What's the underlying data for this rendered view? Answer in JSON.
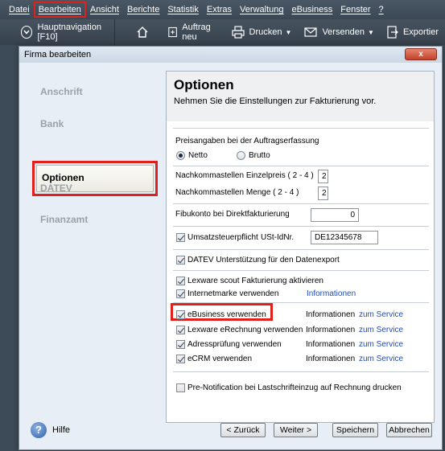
{
  "menu": [
    "Datei",
    "Bearbeiten",
    "Ansicht",
    "Berichte",
    "Statistik",
    "Extras",
    "Verwaltung",
    "eBusiness",
    "Fenster",
    "?"
  ],
  "toolbar": {
    "hauptnav": "Hauptnavigation [F10]",
    "auftrag": "Auftrag neu",
    "drucken": "Drucken",
    "versenden": "Versenden",
    "exportieren": "Exportier"
  },
  "dialog": {
    "title": "Firma bearbeiten",
    "close": "x"
  },
  "nav": {
    "anschrift": "Anschrift",
    "bank": "Bank",
    "optionen": "Optionen",
    "datev": "DATEV",
    "finanzamt": "Finanzamt"
  },
  "panel": {
    "title": "Optionen",
    "subtitle": "Nehmen Sie die Einstellungen zur Fakturierung vor.",
    "preisangaben": "Preisangaben bei der Auftragserfassung",
    "netto": "Netto",
    "brutto": "Brutto",
    "nk_einzelpreis_label": "Nachkommastellen Einzelpreis ( 2 - 4 )",
    "nk_einzelpreis": "2",
    "nk_menge_label": "Nachkommastellen Menge ( 2 - 4 )",
    "nk_menge": "2",
    "fibukonto_label": "Fibukonto bei Direktfakturierung",
    "fibukonto": "0",
    "ust_label": "Umsatzsteuerpflicht",
    "ustid_label": "USt-IdNr.",
    "ustid": "DE12345678",
    "datev_label": "DATEV Unterstützung für den Datenexport",
    "scout_label": "Lexware scout Fakturierung aktivieren",
    "internetmarke_label": "Internetmarke verwenden",
    "internetmarke_info": "Informationen",
    "ebusiness_label": "eBusiness verwenden",
    "erechnung_label": "Lexware eRechnung verwenden",
    "adress_label": "Adressprüfung verwenden",
    "ecrm_label": "eCRM verwenden",
    "info": "Informationen",
    "service": "zum Service",
    "prenotif_label": "Pre-Notification bei Lastschrifteinzug auf Rechnung drucken"
  },
  "footer": {
    "help_icon": "?",
    "help": "Hilfe",
    "back": "< Zurück",
    "next": "Weiter >",
    "save": "Speichern",
    "cancel": "Abbrechen"
  }
}
